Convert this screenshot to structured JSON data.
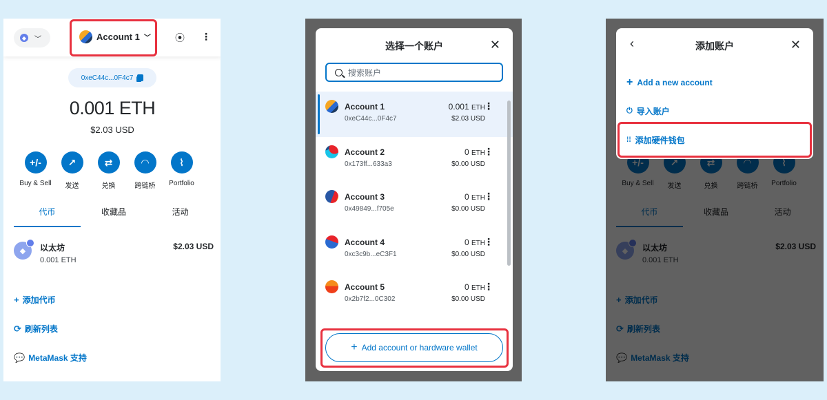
{
  "home": {
    "network_icon": "ethereum-icon",
    "account_name": "Account 1",
    "address_short": "0xeC44c...0F4c7",
    "balance": "0.001 ETH",
    "balance_usd": "$2.03 USD",
    "actions": [
      {
        "label": "Buy & Sell",
        "icon": "+/-"
      },
      {
        "label": "发送",
        "icon": "↗"
      },
      {
        "label": "兑换",
        "icon": "⇄"
      },
      {
        "label": "跨链桥",
        "icon": "◠"
      },
      {
        "label": "Portfolio",
        "icon": "📈"
      }
    ],
    "tabs": [
      "代币",
      "收藏品",
      "活动"
    ],
    "active_tab": "代币",
    "token": {
      "name": "以太坊",
      "amount": "0.001 ETH",
      "usd": "$2.03 USD"
    },
    "links": {
      "add_token": "添加代币",
      "refresh": "刷新列表",
      "support": "MetaMask 支持"
    }
  },
  "select_modal": {
    "title": "选择一个账户",
    "search_placeholder": "搜索账户",
    "accounts": [
      {
        "name": "Account 1",
        "address": "0xeC44c...0F4c7",
        "eth": "0.001",
        "unit": "ETH",
        "usd": "$2.03 USD",
        "selected": true
      },
      {
        "name": "Account 2",
        "address": "0x173ff...633a3",
        "eth": "0",
        "unit": "ETH",
        "usd": "$0.00 USD"
      },
      {
        "name": "Account 3",
        "address": "0x49849...f705e",
        "eth": "0",
        "unit": "ETH",
        "usd": "$0.00 USD"
      },
      {
        "name": "Account 4",
        "address": "0xc3c9b...eC3F1",
        "eth": "0",
        "unit": "ETH",
        "usd": "$0.00 USD"
      },
      {
        "name": "Account 5",
        "address": "0x2b7f2...0C302",
        "eth": "0",
        "unit": "ETH",
        "usd": "$0.00 USD"
      }
    ],
    "add_button": "Add account or hardware wallet"
  },
  "add_modal": {
    "title": "添加账户",
    "options": {
      "new_account": "Add a new account",
      "import": "导入账户",
      "hardware": "添加硬件钱包"
    }
  },
  "colors": {
    "accent": "#0376c9",
    "highlight": "#e8313f",
    "background": "#dbeffa"
  }
}
